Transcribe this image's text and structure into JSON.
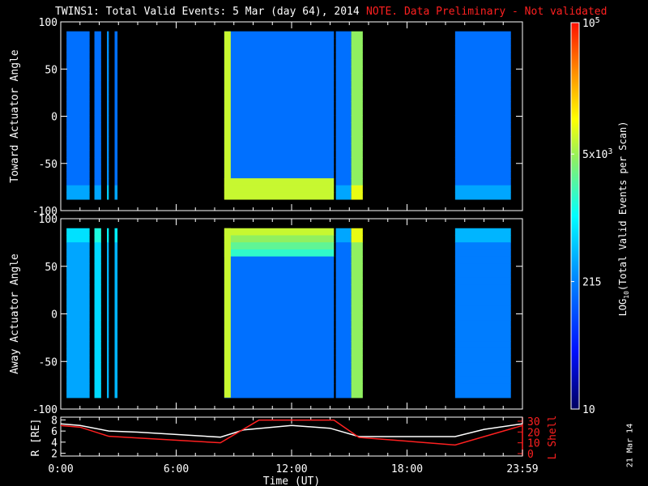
{
  "title": "TWINS1: Total Valid Events:  5 Mar (day  64), 2014",
  "note": "NOTE. Data Preliminary - Not validated",
  "stamp": "21 Mar 14",
  "colors": {
    "note": "#ff2020",
    "lshell": "#ff2020",
    "radius": "#ffffff"
  },
  "chart_data": [
    {
      "type": "heatmap",
      "ylabel": "Toward Actuator Angle",
      "ylim": [
        -100,
        100
      ],
      "yticks": [
        "100",
        "50",
        "0",
        "-50",
        "-100"
      ],
      "xlim_hours": [
        0,
        24
      ],
      "segments": [
        {
          "start": 0.3,
          "end": 1.5,
          "level": 0.3
        },
        {
          "start": 1.75,
          "end": 2.1,
          "level": 0.3
        },
        {
          "start": 2.4,
          "end": 2.5,
          "level": 0.35
        },
        {
          "start": 2.8,
          "end": 2.95,
          "level": 0.3
        },
        {
          "start": 8.5,
          "end": 14.2,
          "level": 0.3,
          "edge_level": 0.7
        },
        {
          "start": 14.3,
          "end": 15.1,
          "level": 0.3
        },
        {
          "start": 15.1,
          "end": 15.7,
          "level": 0.65
        },
        {
          "start": 20.5,
          "end": 23.4,
          "level": 0.3
        }
      ]
    },
    {
      "type": "heatmap",
      "ylabel": "Away Actuator Angle",
      "ylim": [
        -100,
        100
      ],
      "yticks": [
        "100",
        "50",
        "0",
        "-50",
        "-100"
      ],
      "xlim_hours": [
        0,
        24
      ],
      "segments": [
        {
          "start": 0.3,
          "end": 1.5,
          "level": 0.38
        },
        {
          "start": 1.75,
          "end": 2.1,
          "level": 0.45
        },
        {
          "start": 2.4,
          "end": 2.5,
          "level": 0.4
        },
        {
          "start": 2.8,
          "end": 2.95,
          "level": 0.4
        },
        {
          "start": 8.5,
          "end": 14.2,
          "level": 0.3,
          "edge_level": 0.7
        },
        {
          "start": 14.3,
          "end": 15.1,
          "level": 0.3
        },
        {
          "start": 15.1,
          "end": 15.7,
          "level": 0.65
        },
        {
          "start": 20.5,
          "end": 23.4,
          "level": 0.32
        }
      ]
    },
    {
      "type": "line",
      "xlabel": "Time (UT)",
      "xticks": [
        "0:00",
        "6:00",
        "12:00",
        "18:00",
        "23:59"
      ],
      "ylabel": "R [RE]",
      "yticks": [
        "8",
        "6",
        "4",
        "2"
      ],
      "ylim": [
        1.5,
        8.5
      ],
      "y2label": "L Shell",
      "y2ticks": [
        "30",
        "20",
        "10",
        "0"
      ],
      "y2lim": [
        0,
        30
      ],
      "series": [
        {
          "name": "R",
          "x": [
            0,
            1,
            2.5,
            4,
            8.3,
            9.5,
            12,
            14,
            15.5,
            20.5,
            22,
            24
          ],
          "y": [
            7.3,
            7.0,
            6.0,
            5.8,
            4.9,
            6.2,
            7.0,
            6.5,
            5.0,
            5.0,
            6.3,
            7.3
          ]
        },
        {
          "name": "L Shell",
          "x": [
            0,
            1,
            2.5,
            8.3,
            10.3,
            14.2,
            15.5,
            20.5,
            24
          ],
          "y": [
            26,
            24.5,
            16,
            10,
            31,
            31,
            15,
            8,
            26
          ]
        }
      ]
    }
  ],
  "colorbar": {
    "label_pre": "LOG",
    "label_sub": "10",
    "label_post": "(Total Valid Events per Scan)",
    "ticks": [
      {
        "base": "10",
        "exp": "5",
        "frac": 1.0
      },
      {
        "base": "5x10",
        "exp": "3",
        "frac": 0.66
      },
      {
        "base": "215",
        "exp": "",
        "frac": 0.33
      },
      {
        "base": "10",
        "exp": "",
        "frac": 0.0
      }
    ]
  }
}
